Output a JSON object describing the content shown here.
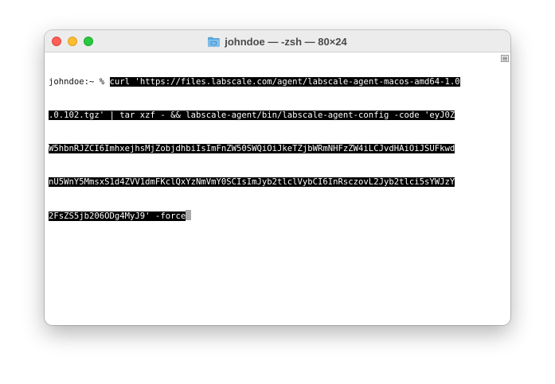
{
  "window": {
    "title": "johndoe — -zsh — 80×24"
  },
  "terminal": {
    "prompt": "johndoe:~ % ",
    "lines": [
      "curl 'https://files.labscale.com/agent/labscale-agent-macos-amd64-1.0",
      ".0.102.tgz' | tar xzf - && labscale-agent/bin/labscale-agent-config -code 'eyJ0Z",
      "W5hbnRJZCI6ImhxejhsMjZobjdhbiIsImFnZW50SWQiOiJkeTZjbWRmNHFzZW4iLCJvdHAiOiJSUFkwd",
      "nU5WnY5MmsxS1d4ZVV1dmFKclQxYzNmVmY0SCIsImJyb2tlclVybCI6InRsczovL2Jyb2tlci5sYWJzY",
      "2FsZS5jb206ODg4MyJ9' -force"
    ]
  },
  "colors": {
    "selection_bg": "#000000",
    "selection_fg": "#ffffff",
    "cursor": "#a9a9a9",
    "close": "#fe5f57",
    "minimize": "#febc2e",
    "zoom": "#28c840",
    "folder": "#5aa7e0"
  },
  "icons": {
    "title_icon": "folder-icon",
    "scroll_icon": "scroll-marker-icon"
  }
}
